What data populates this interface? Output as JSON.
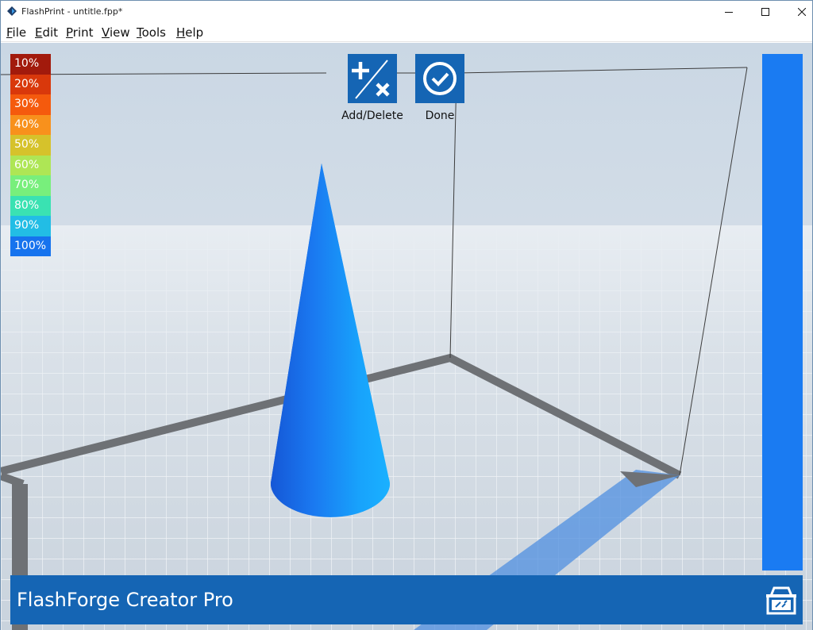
{
  "window": {
    "title": "FlashPrint - untitle.fpp*"
  },
  "menu": [
    {
      "label": "File",
      "accel": "F",
      "rest": "ile"
    },
    {
      "label": "Edit",
      "accel": "E",
      "rest": "dit"
    },
    {
      "label": "Print",
      "accel": "P",
      "rest": "rint"
    },
    {
      "label": "View",
      "accel": "V",
      "rest": "iew"
    },
    {
      "label": "Tools",
      "accel": "T",
      "rest": "ools"
    },
    {
      "label": "Help",
      "accel": "H",
      "rest": "elp"
    }
  ],
  "legend": [
    {
      "label": "10%",
      "color": "#a21a0c"
    },
    {
      "label": "20%",
      "color": "#d9380b"
    },
    {
      "label": "30%",
      "color": "#f55a0d"
    },
    {
      "label": "40%",
      "color": "#f8911c"
    },
    {
      "label": "50%",
      "color": "#d6c22b"
    },
    {
      "label": "60%",
      "color": "#aee655"
    },
    {
      "label": "70%",
      "color": "#78ef7c"
    },
    {
      "label": "80%",
      "color": "#3ae2b2"
    },
    {
      "label": "90%",
      "color": "#22bde5"
    },
    {
      "label": "100%",
      "color": "#1673ee"
    }
  ],
  "toolbar": {
    "add_delete_label": "Add/Delete",
    "done_label": "Done"
  },
  "status": {
    "printer_name": "FlashForge Creator Pro"
  },
  "colors": {
    "accent": "#1565b4",
    "right_bar": "#1a7bf2",
    "cone_dark": "#1557d6",
    "cone_light": "#1ab1ff"
  },
  "icons": {
    "app": "flashprint-logo-icon",
    "add_delete": "plus-slash-x-icon",
    "done": "check-circle-icon",
    "printer": "printer-connect-icon",
    "minimize": "minimize-icon",
    "maximize": "maximize-icon",
    "close": "close-icon"
  }
}
